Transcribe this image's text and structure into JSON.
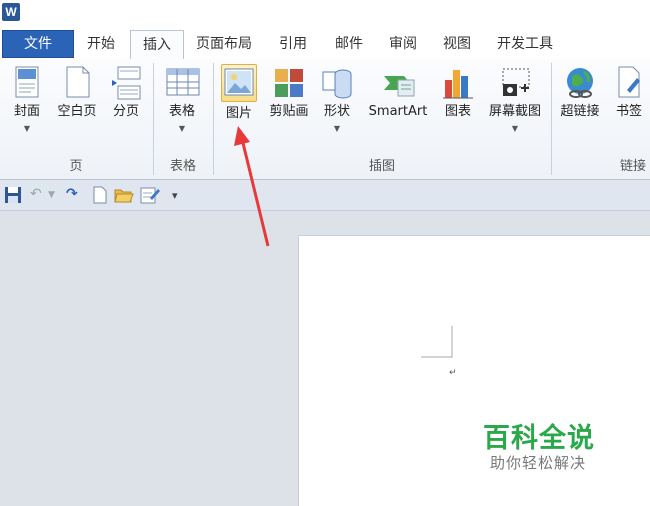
{
  "app": {
    "logo_letter": "W"
  },
  "tabs": [
    {
      "label": "文件"
    },
    {
      "label": "开始"
    },
    {
      "label": "插入"
    },
    {
      "label": "页面布局"
    },
    {
      "label": "引用"
    },
    {
      "label": "邮件"
    },
    {
      "label": "审阅"
    },
    {
      "label": "视图"
    },
    {
      "label": "开发工具"
    }
  ],
  "ribbon": {
    "buttons": {
      "cover": "封面",
      "blank_page": "空白页",
      "page_break": "分页",
      "table": "表格",
      "picture": "图片",
      "clipart": "剪贴画",
      "shapes": "形状",
      "smartart": "SmartArt",
      "chart": "图表",
      "screenshot": "屏幕截图",
      "hyperlink": "超链接",
      "bookmark": "书签"
    },
    "groups": {
      "pages": "页",
      "tables": "表格",
      "illustrations": "插图",
      "links": "链接"
    }
  },
  "document": {
    "paragraph_mark": "↵"
  },
  "watermark": {
    "title": "百科全说",
    "subtitle": "助你轻松解决"
  },
  "colors": {
    "accent": "#2b63b6",
    "watermark_green": "#2aa84a",
    "arrow_red": "#e8393a"
  }
}
